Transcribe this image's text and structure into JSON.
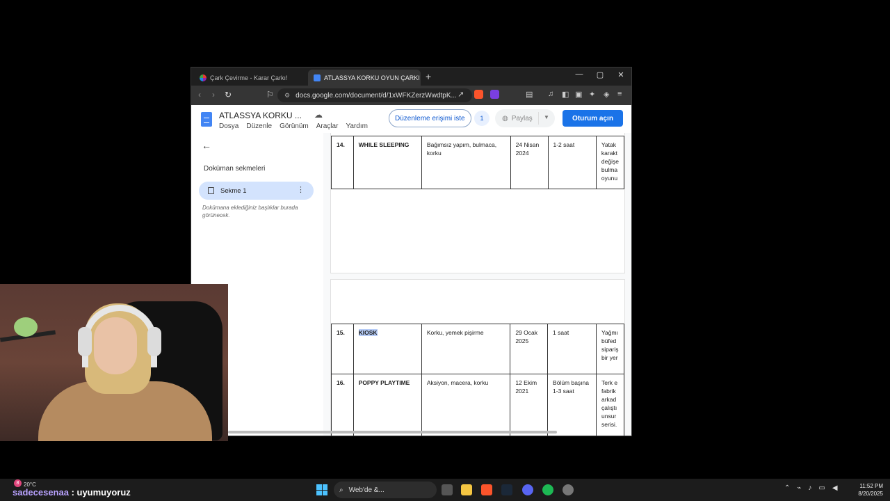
{
  "browser": {
    "tabs": [
      {
        "label": "Çark Çevirme - Karar Çarkı!"
      },
      {
        "label": "ATLASSYA KORKU OYUN ÇARKI"
      }
    ],
    "new_tab": "+",
    "close_tab": "✕",
    "url": "docs.google.com/document/d/1xWFKZerzWwdtpK..."
  },
  "docs": {
    "title": "ATLASSYA KORKU ...",
    "menu": [
      "Dosya",
      "Düzenle",
      "Görünüm",
      "Araçlar",
      "Yardım"
    ],
    "request_edit": "Düzenleme erişimi iste",
    "viewer_count": "1",
    "share": "Paylaş",
    "sign_in": "Oturum açın"
  },
  "sidebar": {
    "heading": "Doküman sekmeleri",
    "tab_label": "Sekme 1",
    "hint": "Dokümana eklediğiniz başlıklar burada görünecek."
  },
  "table_rows_page1": [
    {
      "no": "14.",
      "name": "WHILE SLEEPING",
      "genre": "Bağımsız yapım, bulmaca, korku",
      "date": "24 Nisan 2024",
      "time": "1-2 saat",
      "desc": [
        "Yatak",
        "karakt",
        "değişe",
        "bulma",
        "oyunu"
      ]
    }
  ],
  "table_rows_page2": [
    {
      "no": "15.",
      "name": "KIOSK",
      "genre": "Korku, yemek pişirme",
      "date": "29 Ocak 2025",
      "time": "1 saat",
      "desc": [
        "Yağmı",
        "büfed",
        "sipariş",
        "bir yer"
      ]
    },
    {
      "no": "16.",
      "name": "POPPY PLAYTIME",
      "genre": "Aksiyon, macera, korku",
      "date": "12 Ekim 2021",
      "time": "Bölüm başına 1-3 saat",
      "desc": [
        "Terk e",
        "fabrik",
        "arkad",
        "çalıştı",
        "unsur",
        "serisi."
      ]
    }
  ],
  "taskbar": {
    "weather": "20°C",
    "overlay_badge": "8",
    "overlay_user": "sadecesenaa",
    "overlay_message": " : uyumuyoruz",
    "search_label": "Web'de &...",
    "time": "11:52 PM",
    "date": "8/20/2025"
  },
  "colors": {
    "accent": "#1a73e8",
    "highlight": "#b6ccf7",
    "tab_selected": "#d3e3fd"
  }
}
